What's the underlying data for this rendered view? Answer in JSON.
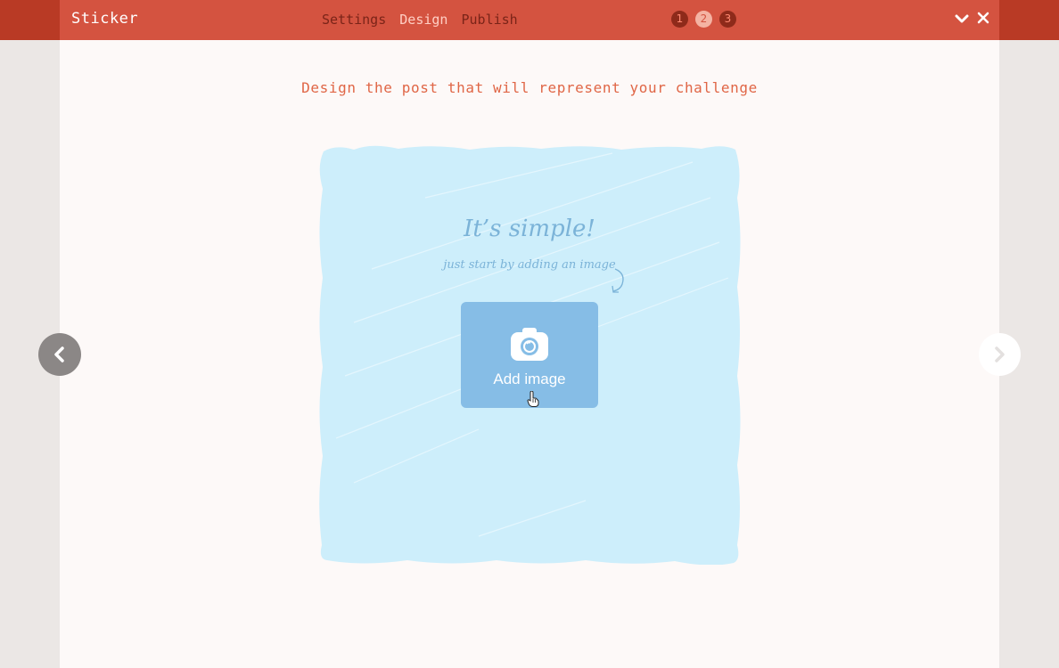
{
  "header": {
    "app_title": "Sticker",
    "steps": [
      "Settings",
      "Design",
      "Publish"
    ],
    "active_step": 2,
    "badges": [
      "1",
      "2",
      "3"
    ]
  },
  "main": {
    "subtitle": "Design the post that will represent your challenge",
    "canvas": {
      "headline": "It’s simple!",
      "hint": "just start by adding an image",
      "add_image_label": "Add image"
    }
  },
  "colors": {
    "header_bg": "#d45340",
    "header_edge": "#b93a25",
    "accent_text": "#e06646",
    "canvas_fill": "#cdeefb",
    "add_button": "#86bde6"
  },
  "icons": {
    "collapse": "chevron-down-icon",
    "close": "close-icon",
    "camera": "camera-icon",
    "prev": "chevron-left-icon",
    "next": "chevron-right-icon"
  }
}
